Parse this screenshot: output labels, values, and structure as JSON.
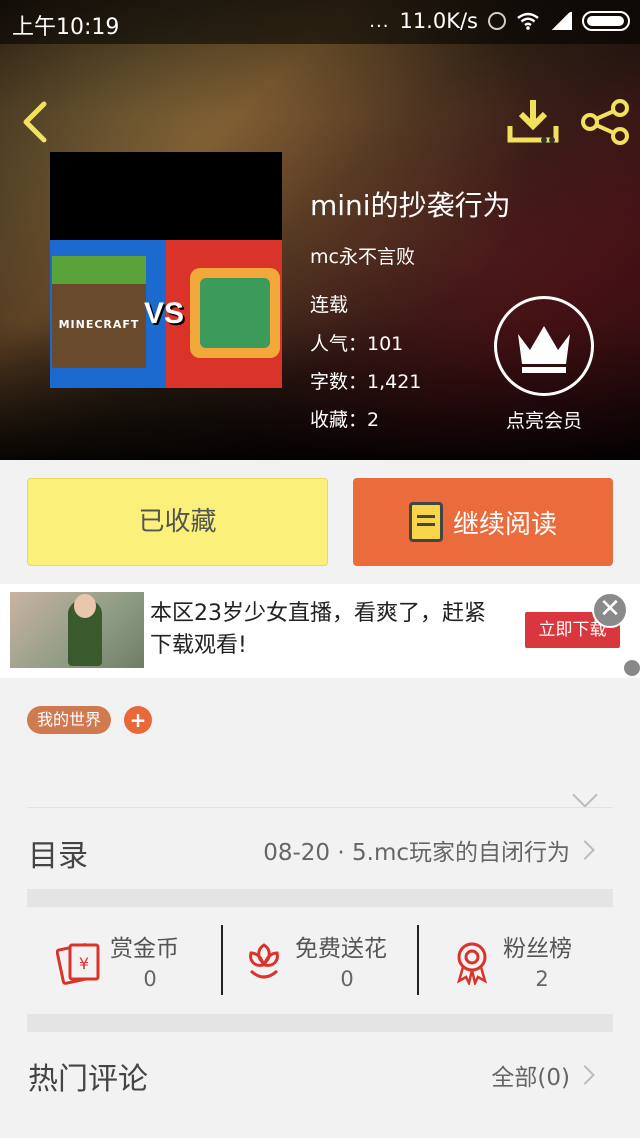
{
  "status_bar": {
    "time": "上午10:19",
    "network_speed": "11.0K/s",
    "dots": "..."
  },
  "header": {
    "icons": [
      "back-icon",
      "download-icon",
      "share-icon"
    ]
  },
  "book": {
    "title": "mini的抄袭行为",
    "author": "mc永不言败",
    "status": "连载",
    "popularity": "人气：101",
    "word_count": "字数：1,421",
    "favorites": "收藏：2",
    "cover_text_left": "MINECRAFT",
    "cover_text_vs": "VS"
  },
  "vip": {
    "label": "点亮会员",
    "icon": "crown-icon"
  },
  "actions": {
    "collected_label": "已收藏",
    "read_label": "继续阅读"
  },
  "ad": {
    "text": "本区23岁少女直播，看爽了，赶紧下载观看!",
    "button_label": "立即下载",
    "close": "✕"
  },
  "tags": {
    "items": [
      "我的世界"
    ],
    "add": "+"
  },
  "catalog": {
    "label": "目录",
    "latest": "08-20 · 5.mc玩家的自闭行为"
  },
  "stats": [
    {
      "name": "赏金币",
      "value": "0",
      "icon": "red-envelope-icon"
    },
    {
      "name": "免费送花",
      "value": "0",
      "icon": "flower-icon"
    },
    {
      "name": "粉丝榜",
      "value": "2",
      "icon": "medal-icon"
    }
  ],
  "comments": {
    "label": "热门评论",
    "all": "全部(0)"
  },
  "colors": {
    "collected_bg": "#fbf07a",
    "read_bg": "#ea6b3c",
    "tag_bg": "#d07a52",
    "ad_button": "#d9363e",
    "icon_red": "#d9332a"
  }
}
